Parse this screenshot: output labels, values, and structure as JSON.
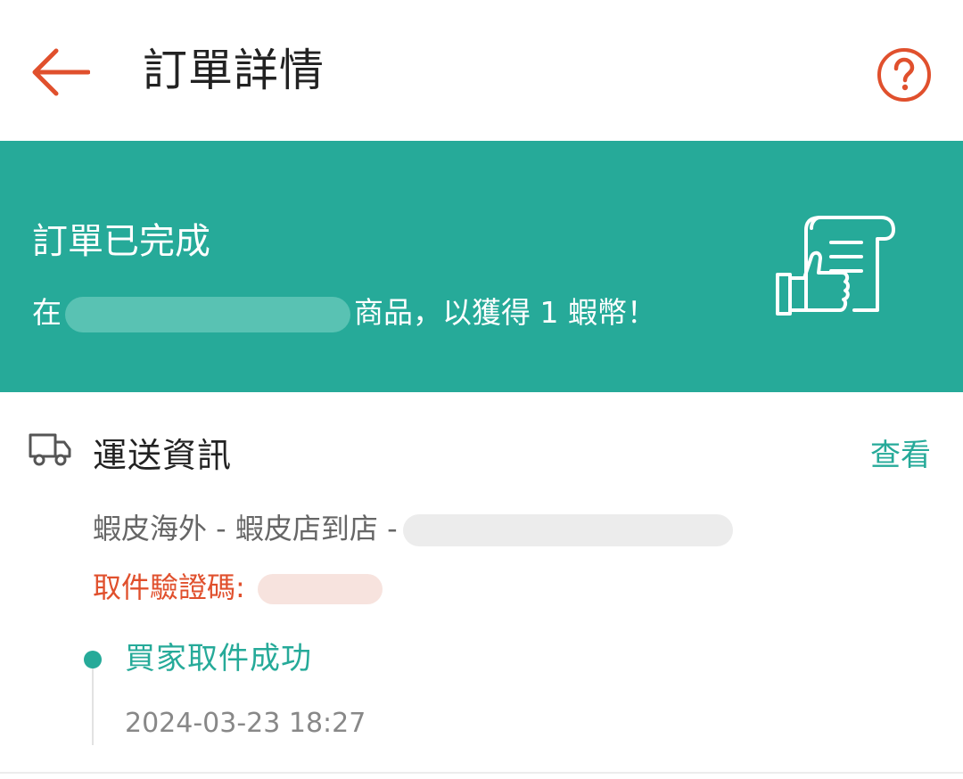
{
  "header": {
    "title": "訂單詳情",
    "back_icon": "back-arrow-icon",
    "help_icon": "help-question-icon"
  },
  "status_banner": {
    "title": "訂單已完成",
    "subtitle_prefix": "在",
    "subtitle_suffix": "商品，以獲得 1 蝦幣！",
    "icon": "receipt-thumbs-up-icon",
    "background_color": "#26aa99"
  },
  "shipping": {
    "title": "運送資訊",
    "view_label": "查看",
    "method_prefix": "蝦皮海外 - 蝦皮店到店 -",
    "pickup_code_label": "取件驗證碼:",
    "timeline": {
      "status": "買家取件成功",
      "time": "2024-03-23 18:27"
    }
  },
  "colors": {
    "accent": "#26aa99",
    "brand": "#e0502d"
  }
}
